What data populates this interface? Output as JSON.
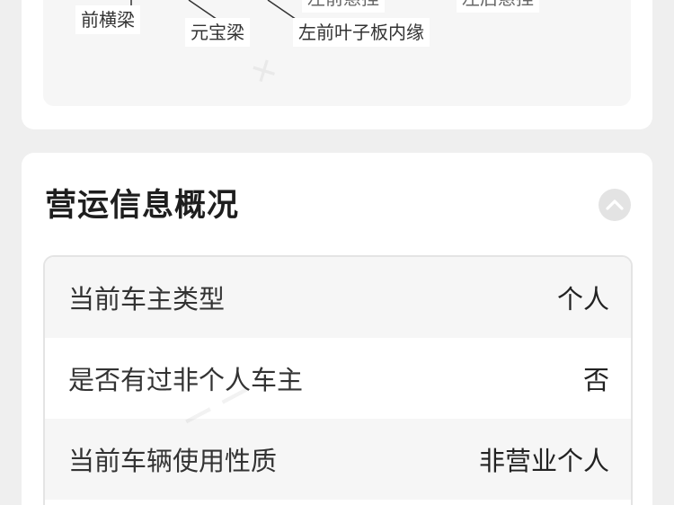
{
  "diagram": {
    "labels": {
      "front_crossbeam": "前横梁",
      "yuanbao_beam": "元宝梁",
      "left_front_leaf_inner": "左前叶子板内缘",
      "left_front_susp_partial": "左前悬挂",
      "left_rear_susp_partial": "左后悬挂"
    }
  },
  "operation": {
    "title": "营运信息概况",
    "rows": [
      {
        "label": "当前车主类型",
        "value": "个人"
      },
      {
        "label": "是否有过非个人车主",
        "value": "否"
      },
      {
        "label": "当前车辆使用性质",
        "value": "非营业个人"
      }
    ]
  },
  "colors": {
    "background": "#efefef",
    "card": "#ffffff",
    "row_alt": "#f6f6f6"
  },
  "icons": {
    "collapse": "chevron-up-icon"
  }
}
